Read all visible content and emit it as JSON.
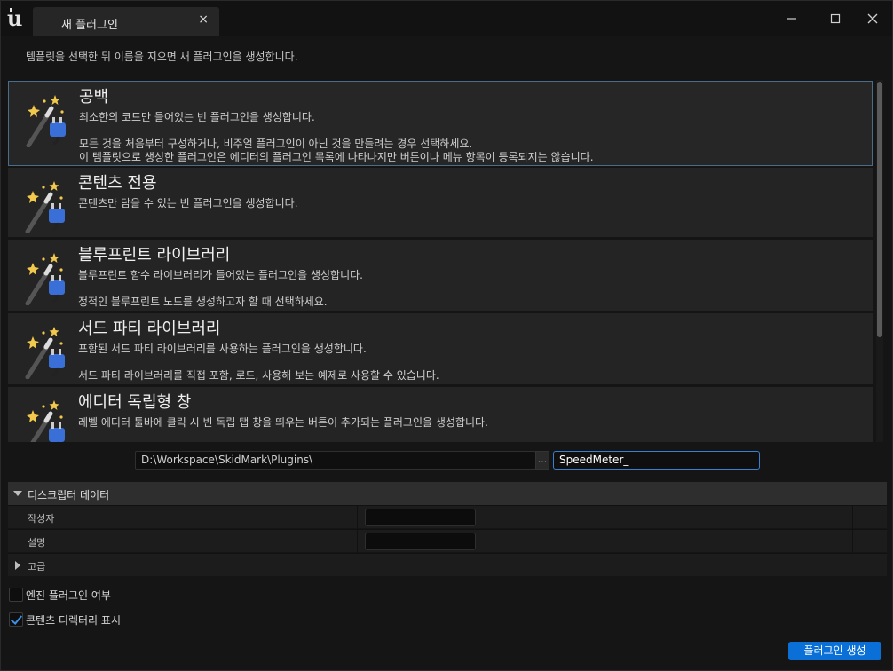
{
  "titlebar": {
    "tab_title": "새 플러그인",
    "tab_close": "×"
  },
  "description": "템플릿을 선택한 뒤 이름을 지으면 새 플러그인을 생성합니다.",
  "templates": [
    {
      "title": "공백",
      "lines": [
        "최소한의 코드만 들어있는 빈 플러그인을 생성합니다.",
        "모든 것을 처음부터 구성하거나, 비주얼 플러그인이 아닌 것을 만들려는 경우 선택하세요.",
        "이 템플릿으로 생성한 플러그인은 에디터의 플러그인 목록에 나타나지만 버튼이나 메뉴 항목이 등록되지는 않습니다."
      ]
    },
    {
      "title": "콘텐츠 전용",
      "lines": [
        "콘텐츠만 담을 수 있는 빈 플러그인을 생성합니다."
      ]
    },
    {
      "title": "블루프린트 라이브러리",
      "lines": [
        "블루프린트 함수 라이브러리가 들어있는 플러그인을 생성합니다.",
        "정적인 블루프린트 노드를 생성하고자 할 때 선택하세요."
      ]
    },
    {
      "title": "서드 파티 라이브러리",
      "lines": [
        "포함된 서드 파티 라이브러리를 사용하는 플러그인을 생성합니다.",
        "서드 파티 라이브러리를 직접 포함, 로드, 사용해 보는 예제로 사용할 수 있습니다."
      ]
    },
    {
      "title": "에디터 독립형 창",
      "lines": [
        "레벨 에디터 툴바에 클릭 시 빈 독립 탭 창을 띄우는 버튼이 추가되는 플러그인을 생성합니다."
      ]
    }
  ],
  "path": {
    "value": "D:\\Workspace\\SkidMark\\Plugins\\",
    "browse_label": "...",
    "name_value": "SpeedMeter_"
  },
  "descriptor": {
    "header": "디스크립터 데이터",
    "author_label": "작성자",
    "description_label": "설명",
    "advanced_label": "고급"
  },
  "options": {
    "engine_plugin_label": "엔진 플러그인 여부",
    "engine_plugin_checked": false,
    "content_dir_label": "콘텐츠 디렉터리 표시",
    "content_dir_checked": true
  },
  "create_button": "플러그인 생성",
  "colors": {
    "accent": "#0a6fd6",
    "selection_border": "#4a6d8c",
    "background": "#151515",
    "item_background": "#242424"
  }
}
